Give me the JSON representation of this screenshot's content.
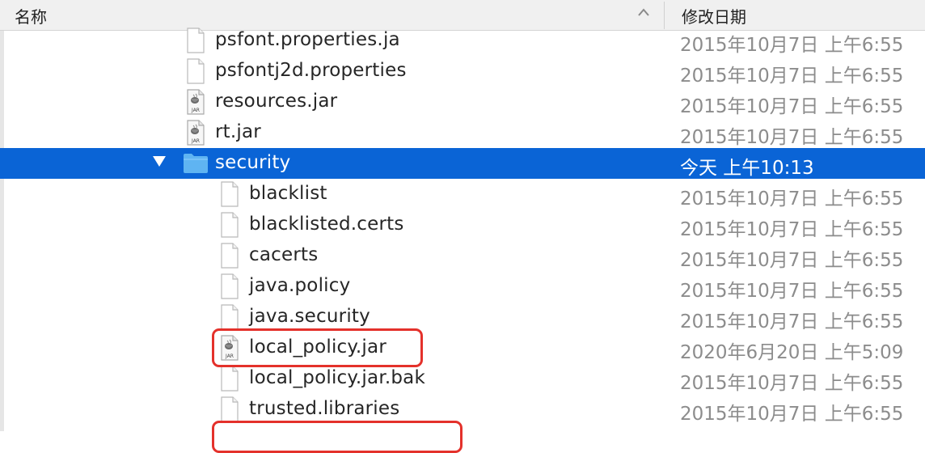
{
  "header": {
    "name_label": "名称",
    "date_label": "修改日期",
    "sort_indicator": "^"
  },
  "files": [
    {
      "name": "psfont.properties.ja",
      "date": "2015年10月7日 上午6:55",
      "kind": "file",
      "level": 1,
      "selected": false,
      "partial": true
    },
    {
      "name": "psfontj2d.properties",
      "date": "2015年10月7日 上午6:55",
      "kind": "file",
      "level": 1,
      "selected": false
    },
    {
      "name": "resources.jar",
      "date": "2015年10月7日 上午6:55",
      "kind": "jar",
      "level": 1,
      "selected": false
    },
    {
      "name": "rt.jar",
      "date": "2015年10月7日 上午6:55",
      "kind": "jar",
      "level": 1,
      "selected": false
    },
    {
      "name": "security",
      "date": "今天 上午10:13",
      "kind": "folder",
      "level": 1,
      "selected": true,
      "expanded": true
    },
    {
      "name": "blacklist",
      "date": "2015年10月7日 上午6:55",
      "kind": "file",
      "level": 2,
      "selected": false
    },
    {
      "name": "blacklisted.certs",
      "date": "2015年10月7日 上午6:55",
      "kind": "file",
      "level": 2,
      "selected": false
    },
    {
      "name": "cacerts",
      "date": "2015年10月7日 上午6:55",
      "kind": "file",
      "level": 2,
      "selected": false
    },
    {
      "name": "java.policy",
      "date": "2015年10月7日 上午6:55",
      "kind": "file",
      "level": 2,
      "selected": false
    },
    {
      "name": "java.security",
      "date": "2015年10月7日 上午6:55",
      "kind": "file",
      "level": 2,
      "selected": false
    },
    {
      "name": "local_policy.jar",
      "date": "2020年6月20日 上午5:09",
      "kind": "jar",
      "level": 2,
      "selected": false,
      "highlighted": true
    },
    {
      "name": "local_policy.jar.bak",
      "date": "2015年10月7日 上午6:55",
      "kind": "file",
      "level": 2,
      "selected": false
    },
    {
      "name": "trusted.libraries",
      "date": "2015年10月7日 上午6:55",
      "kind": "file",
      "level": 2,
      "selected": false
    }
  ],
  "colors": {
    "selection": "#0a64d6",
    "highlight_box": "#e4312b",
    "folder": "#5fb4f2"
  },
  "icons": {
    "file": "document-icon",
    "jar": "jar-file-icon",
    "folder": "folder-icon",
    "disclosure": "disclosure-triangle-down-icon"
  },
  "jar_icon_text": "JAR"
}
